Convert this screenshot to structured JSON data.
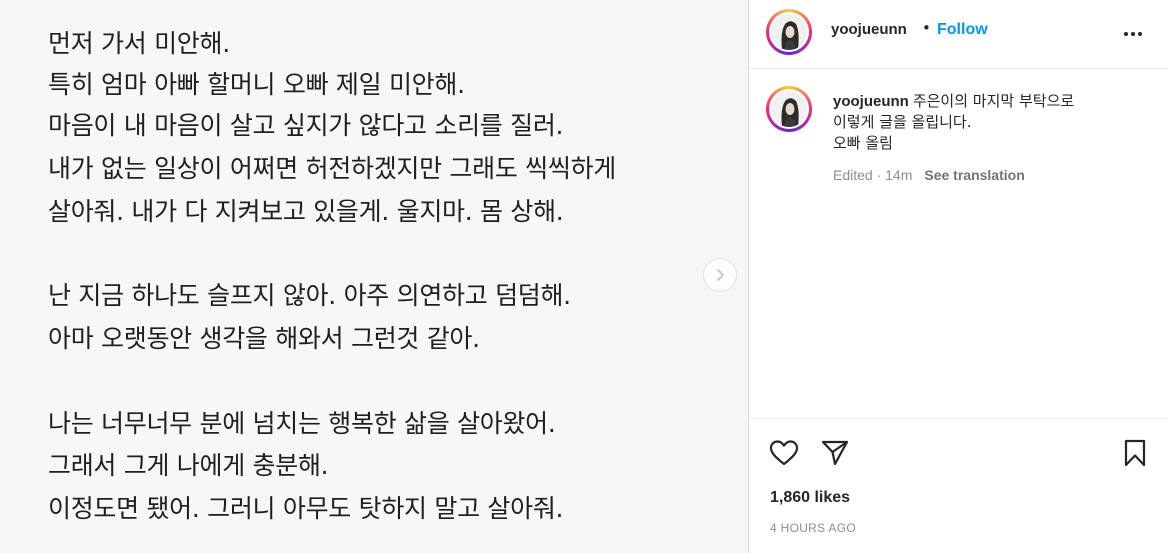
{
  "post": {
    "image_lines": [
      "먼저 가서 미안해.",
      "특히 엄마 아빠 할머니 오빠 제일 미안해.",
      "마음이 내 마음이 살고 싶지가 않다고 소리를 질러.",
      "내가 없는 일상이 어쩌면 허전하겠지만 그래도 씩씩하게",
      "살아줘. 내가 다 지켜보고 있을게. 울지마. 몸 상해.",
      "난 지금 하나도 슬프지 않아. 아주 의연하고 덤덤해.",
      "아마 오랫동안 생각을 해와서 그런것 같아.",
      "나는 너무너무 분에 넘치는 행복한 삶을 살아왔어.",
      "그래서 그게 나에게 충분해.",
      "이정도면 됐어. 그러니 아무도 탓하지 말고 살아줘."
    ],
    "next_icon": "chevron-right-icon"
  },
  "header": {
    "username": "yoojueunn",
    "separator": "•",
    "follow_label": "Follow",
    "more_icon": "more-horizontal-icon"
  },
  "caption": {
    "username": "yoojueunn",
    "lines": [
      "주은이의 마지막 부탁으로",
      "이렇게 글을 올립니다.",
      "오빠 올림"
    ],
    "edited": "Edited · 14m",
    "see_translation": "See translation"
  },
  "actions": {
    "like_icon": "heart-icon",
    "share_icon": "paper-plane-icon",
    "save_icon": "bookmark-icon",
    "likes": "1,860 likes",
    "time": "4 HOURS AGO"
  },
  "colors": {
    "accent": "#0095f6",
    "secondary_text": "#8e8e8e",
    "border": "#dbdbdb",
    "image_background": "#f7f7f7"
  }
}
